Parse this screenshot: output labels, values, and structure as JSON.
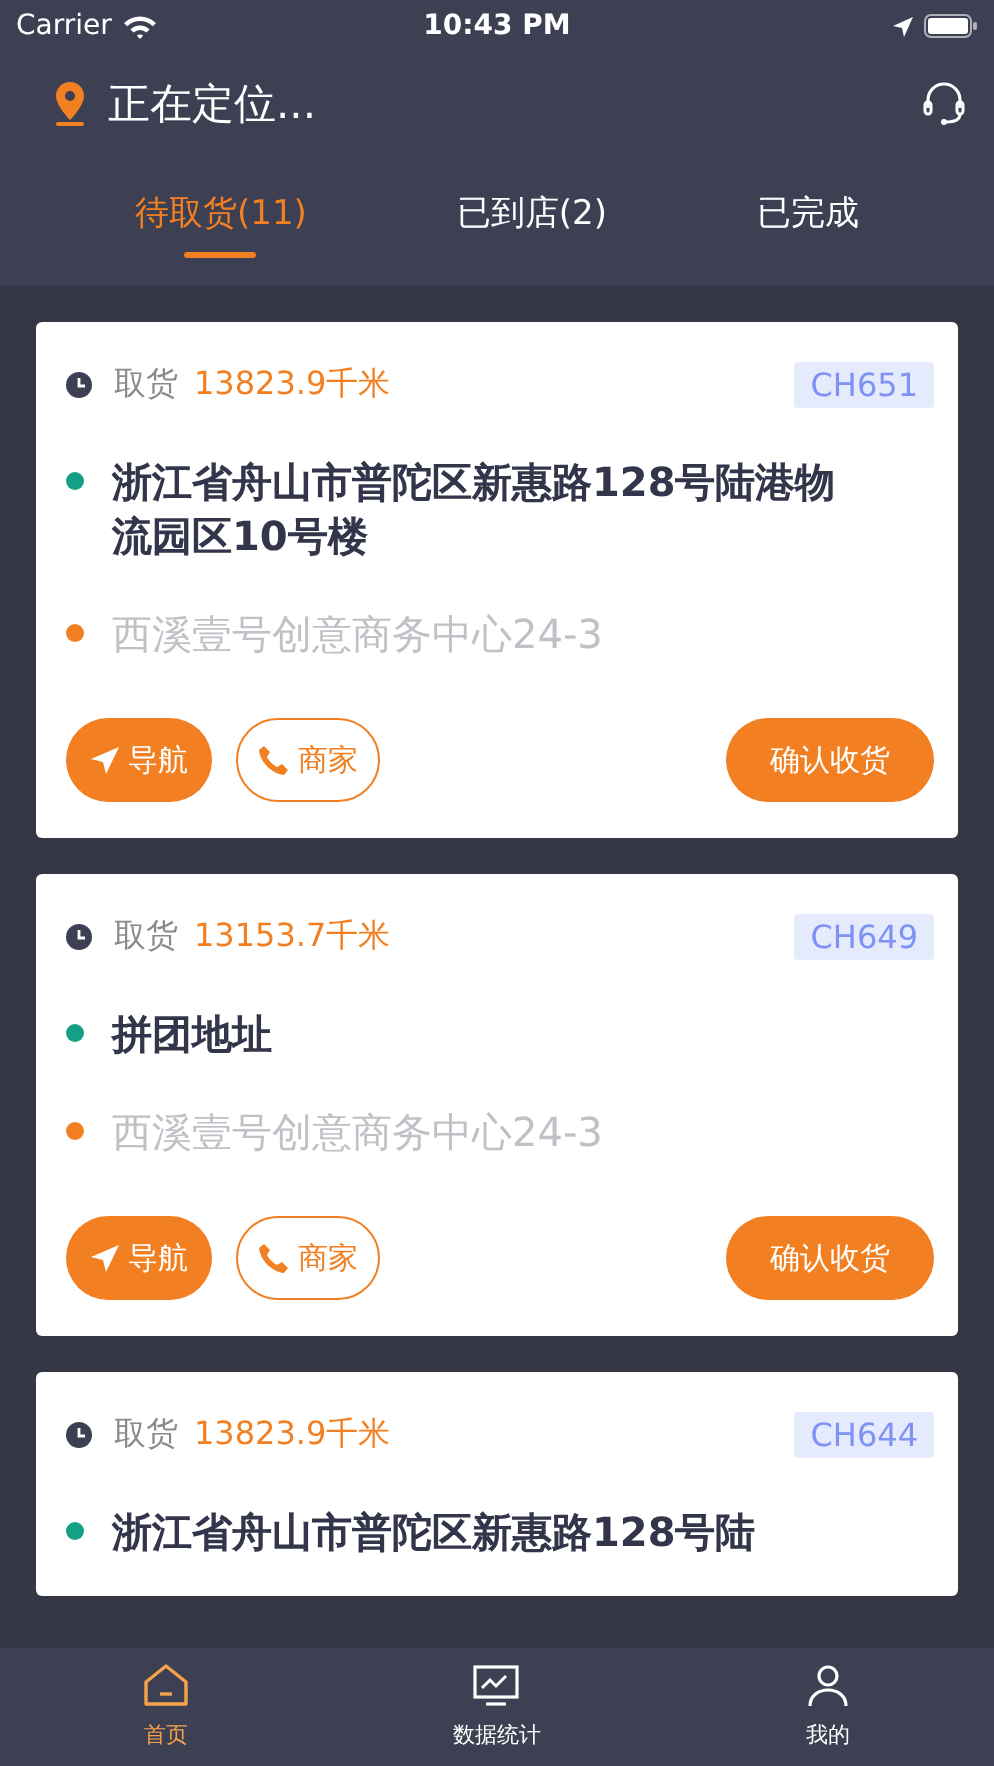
{
  "status_bar": {
    "carrier": "Carrier",
    "time": "10:43 PM"
  },
  "header": {
    "location": "正在定位..."
  },
  "tabs": [
    {
      "label": "待取货(11)",
      "selected": true
    },
    {
      "label": "已到店(2)",
      "selected": false
    },
    {
      "label": "已完成",
      "selected": false
    }
  ],
  "orders": [
    {
      "pickup_label": "取货",
      "distance": "13823.9千米",
      "code": "CH651",
      "address": "浙江省舟山市普陀区新惠路128号陆港物流园区10号楼",
      "store": "西溪壹号创意商务中心24-3",
      "nav_button": "导航",
      "merchant_button": "商家",
      "confirm_button": "确认收货"
    },
    {
      "pickup_label": "取货",
      "distance": "13153.7千米",
      "code": "CH649",
      "address": "拼团地址",
      "store": "西溪壹号创意商务中心24-3",
      "nav_button": "导航",
      "merchant_button": "商家",
      "confirm_button": "确认收货"
    },
    {
      "pickup_label": "取货",
      "distance": "13823.9千米",
      "code": "CH644",
      "address": "浙江省舟山市普陀区新惠路128号陆"
    }
  ],
  "bottom_nav": [
    {
      "label": "首页",
      "selected": true
    },
    {
      "label": "数据统计",
      "selected": false
    },
    {
      "label": "我的",
      "selected": false
    }
  ]
}
